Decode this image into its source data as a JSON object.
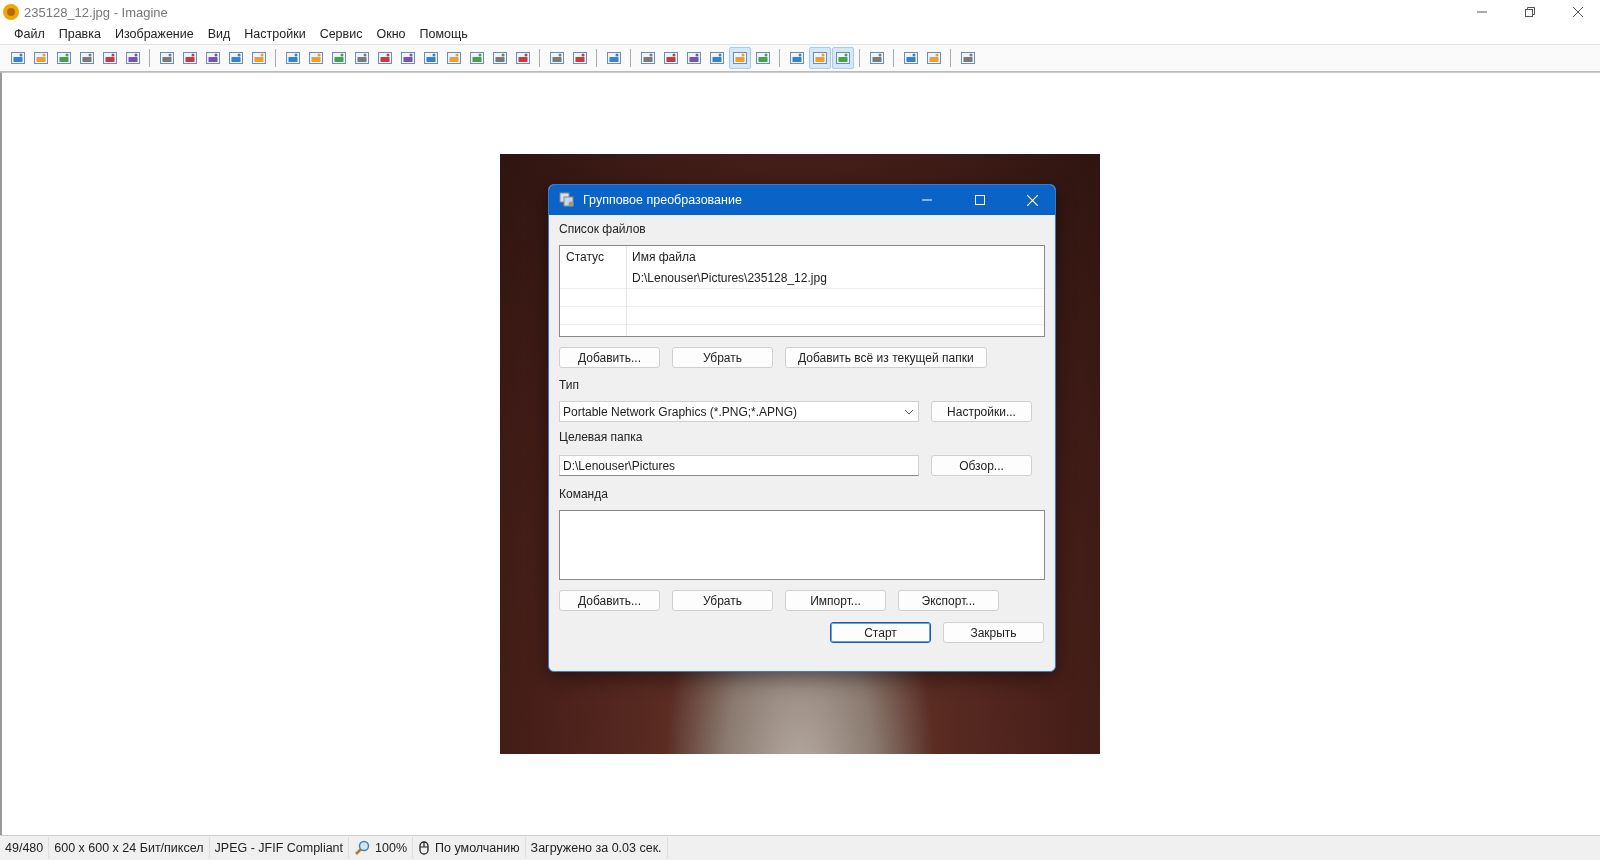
{
  "window": {
    "title": "235128_12.jpg - Imagine"
  },
  "menu": [
    "Файл",
    "Правка",
    "Изображение",
    "Вид",
    "Настройки",
    "Сервис",
    "Окно",
    "Помощь"
  ],
  "toolbar": [
    [
      {
        "selected": false
      },
      {
        "selected": false
      },
      {
        "selected": false
      },
      {
        "selected": false
      },
      {
        "selected": false
      },
      {
        "selected": false
      }
    ],
    [
      {
        "selected": false
      },
      {
        "selected": false
      },
      {
        "selected": false
      },
      {
        "selected": false
      },
      {
        "selected": false
      }
    ],
    [
      {
        "selected": false
      },
      {
        "selected": false
      },
      {
        "selected": false
      },
      {
        "selected": false
      },
      {
        "selected": false
      },
      {
        "selected": false
      },
      {
        "selected": false
      },
      {
        "selected": false
      },
      {
        "selected": false
      },
      {
        "selected": false
      },
      {
        "selected": false
      }
    ],
    [
      {
        "selected": false
      },
      {
        "selected": false
      }
    ],
    [
      {
        "selected": false
      }
    ],
    [
      {
        "selected": false
      },
      {
        "selected": false
      },
      {
        "selected": false
      },
      {
        "selected": false
      },
      {
        "selected": true
      },
      {
        "selected": false
      }
    ],
    [
      {
        "selected": false
      },
      {
        "selected": true
      },
      {
        "selected": true
      }
    ],
    [
      {
        "selected": false
      }
    ],
    [
      {
        "selected": false
      },
      {
        "selected": false
      }
    ],
    [
      {
        "selected": false
      }
    ]
  ],
  "dialog": {
    "title": "Групповое преобразование",
    "file_list_label": "Список файлов",
    "columns": [
      "Статус",
      "Имя файла"
    ],
    "rows": [
      {
        "status": "",
        "file": "D:\\Lenouser\\Pictures\\235128_12.jpg"
      }
    ],
    "file_buttons": [
      "Добавить...",
      "Убрать",
      "Добавить всё из текущей папки"
    ],
    "type_label": "Тип",
    "type_value": "Portable Network Graphics (*.PNG;*.APNG)",
    "settings_button": "Настройки...",
    "target_label": "Целевая папка",
    "target_value": "D:\\Lenouser\\Pictures",
    "browse_button": "Обзор...",
    "command_label": "Команда",
    "command_buttons": [
      "Добавить...",
      "Убрать",
      "Импорт...",
      "Экспорт..."
    ],
    "start_button": "Старт",
    "close_button": "Закрыть"
  },
  "status_bar": [
    {
      "kind": "text",
      "text": "49/480"
    },
    {
      "kind": "text",
      "text": "600 x 600 x 24 Бит/пиксел"
    },
    {
      "kind": "text",
      "text": "JPEG - JFIF Compliant"
    },
    {
      "kind": "zoom",
      "text": "100%"
    },
    {
      "kind": "mouse",
      "text": "По умолчанию"
    },
    {
      "kind": "text",
      "text": "Загружено за 0.03 сек."
    }
  ]
}
